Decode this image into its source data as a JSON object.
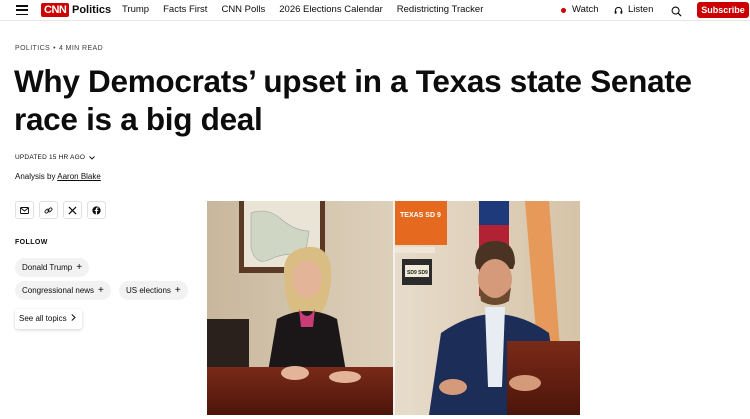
{
  "nav": {
    "logo": "CNN",
    "section": "Politics",
    "links": [
      "Trump",
      "Facts First",
      "CNN Polls",
      "2026 Elections Calendar",
      "Redistricting Tracker"
    ],
    "watch": "Watch",
    "listen": "Listen",
    "subscribe": "Subscribe",
    "accent_color": "#cc0000"
  },
  "article": {
    "section": "Politics",
    "read_time": "4 min read",
    "headline": "Why Democrats’ upset in a Texas state Senate race is a big deal",
    "updated": "Updated 15 hr ago",
    "byline_prefix": "Analysis by",
    "author": "Aaron Blake"
  },
  "share": {
    "icons": [
      "email-icon",
      "link-icon",
      "x-icon",
      "facebook-icon"
    ]
  },
  "follow": {
    "label": "Follow",
    "topics": [
      "Donald Trump",
      "Congressional news",
      "US elections"
    ],
    "see_all": "See all topics"
  },
  "photo": {
    "sign_text": "TEXAS SD 9",
    "plate_text": "SD9 SD9"
  }
}
